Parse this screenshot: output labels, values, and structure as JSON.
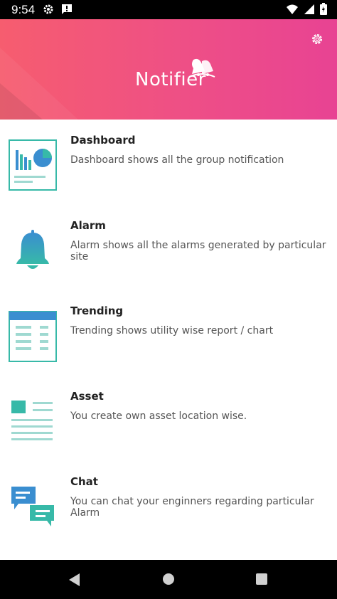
{
  "status_bar": {
    "time": "9:54",
    "icons": [
      "gear-icon",
      "message-icon",
      "wifi-icon",
      "signal-icon",
      "battery-icon"
    ]
  },
  "header": {
    "app_name": "Notifier",
    "logo_icon": "bells-icon",
    "settings_icon": "gear-icon",
    "gradient_start": "#f65d6f",
    "gradient_end": "#e84393"
  },
  "features": [
    {
      "title": "Dashboard",
      "description": "Dashboard shows all the group notification",
      "icon": "dashboard-icon"
    },
    {
      "title": "Alarm",
      "description": "Alarm shows all the alarms generated by particular site",
      "icon": "bell-icon"
    },
    {
      "title": "Trending",
      "description": "Trending shows utility wise report / chart",
      "icon": "table-icon"
    },
    {
      "title": "Asset",
      "description": "You create own asset location wise.",
      "icon": "document-icon"
    },
    {
      "title": "Chat",
      "description": "You can chat your enginners regarding particular Alarm",
      "icon": "chat-icon"
    }
  ],
  "nav_bar": {
    "buttons": [
      "back-icon",
      "home-icon",
      "recents-icon"
    ]
  },
  "colors": {
    "accent_teal": "#37b9a8",
    "accent_blue": "#3a8ed0"
  }
}
